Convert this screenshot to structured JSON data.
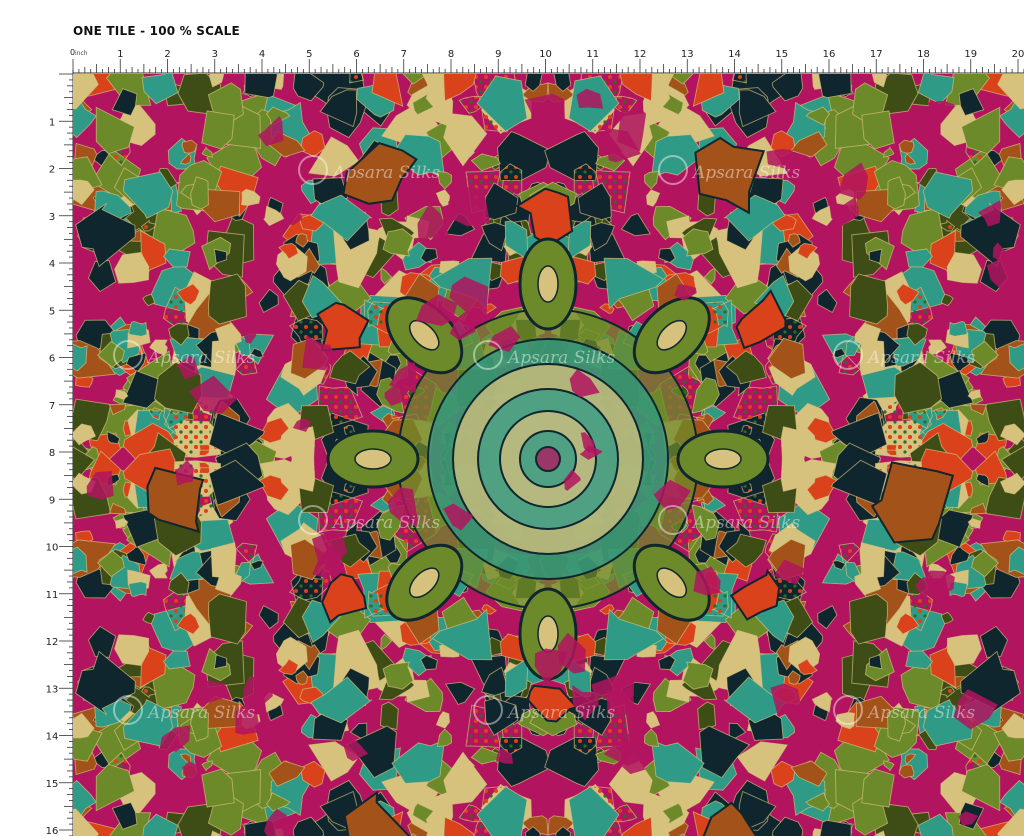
{
  "header": {
    "title": "ONE TILE - 100 % SCALE"
  },
  "ruler": {
    "unit_label": "inch",
    "top_numbers": [
      "0",
      "1",
      "2",
      "3",
      "4",
      "5",
      "6",
      "7",
      "8",
      "9",
      "10",
      "11",
      "12",
      "13",
      "14",
      "15",
      "16",
      "17",
      "18",
      "19",
      "20"
    ],
    "left_numbers": [
      "1",
      "2",
      "3",
      "4",
      "5",
      "6",
      "7",
      "8",
      "9",
      "10",
      "11",
      "12",
      "13",
      "14",
      "15",
      "16"
    ]
  },
  "pattern": {
    "description_icon": "kaleidoscope-mandala-print",
    "watermark_text": "Apsara Silks",
    "palette": {
      "magenta": "#b2145f",
      "teal": "#2f9a86",
      "navy": "#10262e",
      "olive": "#6d8a2b",
      "khaki": "#d7c27d",
      "orange": "#d9421a",
      "brown": "#a3531a",
      "dark_olive": "#3e4d16"
    }
  }
}
